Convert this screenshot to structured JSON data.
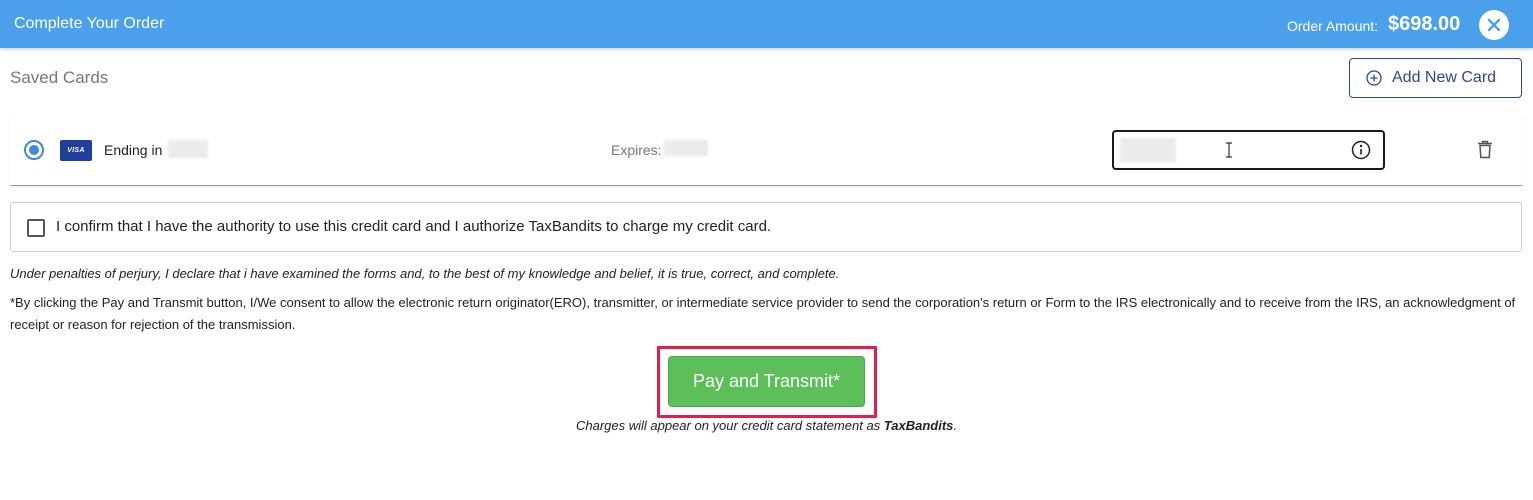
{
  "header": {
    "title": "Complete Your Order",
    "amount_label": "Order Amount:",
    "amount_value": "$698.00",
    "close_icon": "close-icon",
    "background_color": "#4aa0ea"
  },
  "saved_cards": {
    "title": "Saved Cards",
    "add_button_label": "Add New Card",
    "add_icon": "plus-circle-icon",
    "card": {
      "brand": "VISA",
      "ending_label": "Ending in",
      "expires_label": "Expires:",
      "selected": true,
      "info_icon": "info-icon",
      "delete_icon": "trash-icon"
    }
  },
  "confirm": {
    "text": "I confirm that I have the authority to use this credit card and I authorize TaxBandits to charge my credit card.",
    "checked": false
  },
  "legal": {
    "perjury": "Under penalties of perjury, I declare that i have examined the forms and, to the best of my knowledge and belief, it is true, correct, and complete.",
    "consent": "*By clicking the Pay and Transmit button, I/We consent to allow the electronic return originator(ERO), transmitter, or intermediate service provider to send the corporation's return or Form to the IRS electronically and to receive from the IRS, an acknowledgment of receipt or reason for rejection of the transmission."
  },
  "pay": {
    "button_label": "Pay and Transmit*",
    "button_color": "#5cbf5a",
    "highlight_color": "#e0204b",
    "charges_prefix": "Charges will appear on your credit card statement as ",
    "charges_brand": "TaxBandits",
    "charges_suffix": "."
  }
}
